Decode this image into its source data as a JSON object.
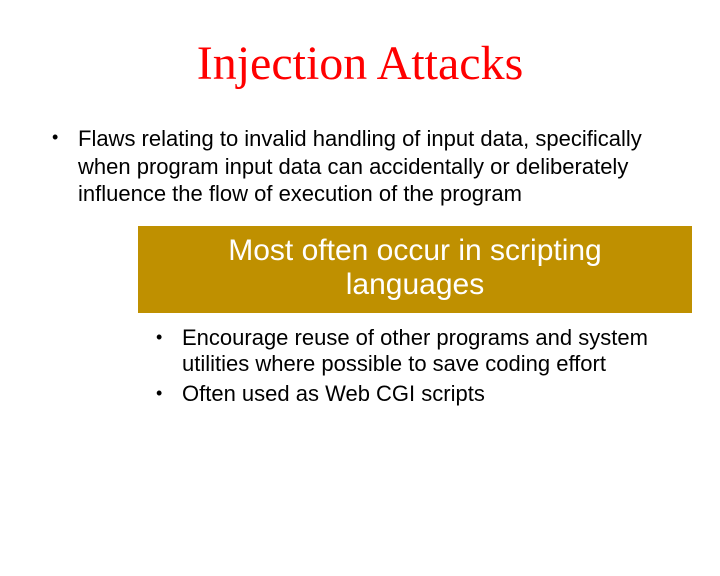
{
  "title": "Injection Attacks",
  "bullets": [
    "Flaws relating to invalid handling of input data, specifically when program input data can accidentally or deliberately influence the flow of execution of the program"
  ],
  "box": {
    "header": "Most often occur in scripting languages",
    "items": [
      "Encourage reuse of other programs and system utilities where possible to save coding effort",
      "Often used as Web CGI scripts"
    ]
  }
}
